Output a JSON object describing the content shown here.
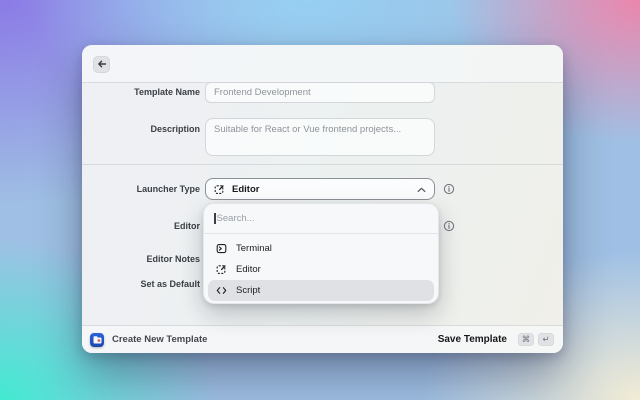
{
  "header": {
    "back_icon": "arrow-left"
  },
  "form": {
    "template_name": {
      "label": "Template Name",
      "value": "Frontend Development"
    },
    "description": {
      "label": "Description",
      "value": "Suitable for React or Vue frontend projects..."
    },
    "launcher_type": {
      "label": "Launcher Type",
      "value": "Editor",
      "value_icon": "editor-icon",
      "chevron": "up"
    },
    "editor": {
      "label": "Editor"
    },
    "editor_notes": {
      "label": "Editor Notes"
    },
    "set_as_default": {
      "label": "Set as Default"
    }
  },
  "dropdown": {
    "search_placeholder": "Search...",
    "options": [
      {
        "label": "Terminal",
        "icon": "terminal-icon",
        "highlighted": false
      },
      {
        "label": "Editor",
        "icon": "editor-icon",
        "highlighted": false
      },
      {
        "label": "Script",
        "icon": "script-icon",
        "highlighted": true
      }
    ]
  },
  "footer": {
    "app_title": "Create New Template",
    "save_label": "Save Template",
    "shortcuts": [
      "⌘",
      "↵"
    ]
  },
  "colors": {
    "accent_blue": "#2257c4",
    "option_highlight": "#dfe1e4",
    "wallpaper_purple": "#8b7ae6",
    "wallpaper_pink": "#ec86ac",
    "wallpaper_teal": "#43ead2",
    "wallpaper_cream": "#f2ecd5",
    "wallpaper_blue": "#96cff2"
  }
}
